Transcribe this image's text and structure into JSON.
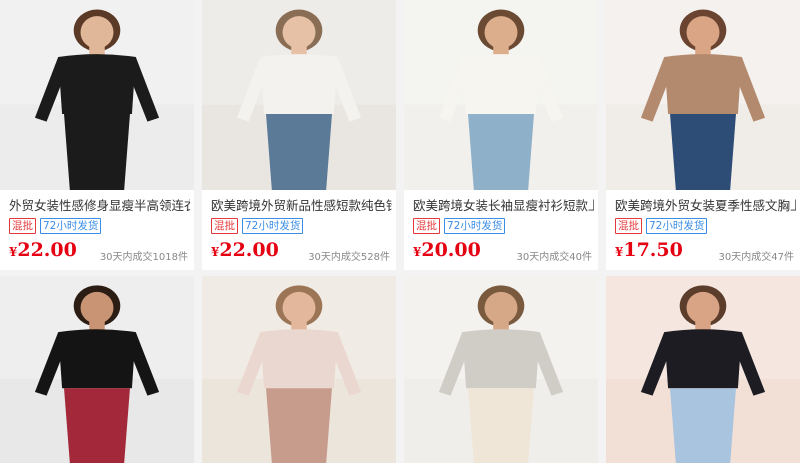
{
  "products": [
    {
      "title": "外贸女装性感修身显瘦半高领连衣裙",
      "tags": [
        "混批",
        "72小时发货"
      ],
      "currency": "¥",
      "price": "22.00",
      "sales": "30天内成交1018件",
      "colors": {
        "bg": "#ececec",
        "cloth": "#1b1b1b",
        "skin": "#e1b79a",
        "hair": "#5a3a26",
        "accent": "#1b1b1b"
      }
    },
    {
      "title": "欧美跨境外贸新品性感短款纯色针织上衣",
      "tags": [
        "混批",
        "72小时发货"
      ],
      "currency": "¥",
      "price": "22.00",
      "sales": "30天内成交528件",
      "colors": {
        "bg": "#e9e6e2",
        "cloth": "#f4f2ee",
        "skin": "#e6c1a6",
        "hair": "#8a6d55",
        "accent": "#5a7a98"
      }
    },
    {
      "title": "欧美跨境女装长袖显瘦衬衫短款上衣",
      "tags": [
        "混批",
        "72小时发货"
      ],
      "currency": "¥",
      "price": "20.00",
      "sales": "30天内成交40件",
      "colors": {
        "bg": "#f1f0ec",
        "cloth": "#f7f5f0",
        "skin": "#dcae8c",
        "hair": "#6b4a33",
        "accent": "#8fb0c9"
      }
    },
    {
      "title": "欧美跨境外贸女装夏季性感文胸上衣",
      "tags": [
        "混批",
        "72小时发货"
      ],
      "currency": "¥",
      "price": "17.50",
      "sales": "30天内成交47件",
      "colors": {
        "bg": "#f0ece8",
        "cloth": "#b38a6e",
        "skin": "#d9a585",
        "hair": "#6a4431",
        "accent": "#2d4d77"
      }
    },
    {
      "colors": {
        "bg": "#e8e8e8",
        "cloth": "#141414",
        "skin": "#c89474",
        "hair": "#2b1c14",
        "accent": "#a3283a"
      }
    },
    {
      "colors": {
        "bg": "#ece5dc",
        "cloth": "#ead7cf",
        "skin": "#e2b79b",
        "hair": "#9c7556",
        "accent": "#c79c8c"
      }
    },
    {
      "colors": {
        "bg": "#efeeea",
        "cloth": "#cfcdc6",
        "skin": "#d6a887",
        "hair": "#7a5a3e",
        "accent": "#efe6d8"
      }
    },
    {
      "colors": {
        "bg": "#f2dfd6",
        "cloth": "#1c1c22",
        "skin": "#d9a485",
        "hair": "#5c3c2a",
        "accent": "#a9c4de"
      }
    }
  ]
}
